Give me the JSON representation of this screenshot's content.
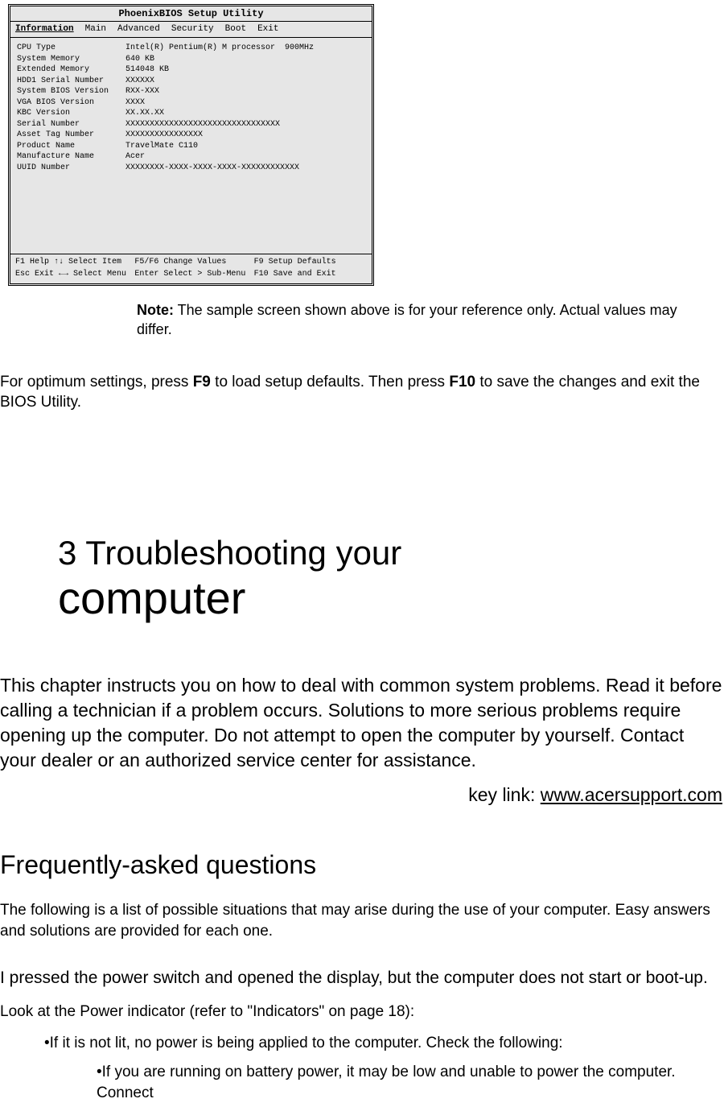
{
  "bios": {
    "title": "PhoenixBIOS Setup Utility",
    "menu": [
      "Information",
      "Main",
      "Advanced",
      "Security",
      "Boot",
      "Exit"
    ],
    "rows": [
      {
        "label": "CPU Type",
        "value": "Intel(R) Pentium(R) M processor  900MHz"
      },
      {
        "label": "System Memory",
        "value": "640 KB"
      },
      {
        "label": "Extended Memory",
        "value": "514048 KB"
      },
      {
        "label": "HDD1 Serial Number",
        "value": "XXXXXX"
      },
      {
        "label": "System BIOS Version",
        "value": "RXX-XXX"
      },
      {
        "label": "VGA BIOS Version",
        "value": "XXXX"
      },
      {
        "label": "KBC Version",
        "value": "XX.XX.XX"
      },
      {
        "label": "Serial Number",
        "value": "XXXXXXXXXXXXXXXXXXXXXXXXXXXXXXXX"
      },
      {
        "label": "Asset Tag Number",
        "value": "XXXXXXXXXXXXXXXX"
      },
      {
        "label": "Product Name",
        "value": "TravelMate C110"
      },
      {
        "label": "Manufacture Name",
        "value": "Acer"
      },
      {
        "label": "UUID Number",
        "value": "XXXXXXXX-XXXX-XXXX-XXXX-XXXXXXXXXXXX"
      }
    ],
    "footer": [
      "F1  Help  ↑↓ Select Item",
      "F5/F6 Change Values",
      "F9  Setup Defaults",
      "Esc Exit  ←→ Select Menu",
      "Enter Select > Sub-Menu",
      "F10 Save and Exit"
    ]
  },
  "note": {
    "label": "Note:",
    "text": "  The sample screen shown above is for your reference only.  Actual values may differ."
  },
  "optimum": {
    "pre": "For optimum settings, press ",
    "k1": "F9",
    "mid": " to load setup defaults.  Then press ",
    "k2": "F10",
    "post": " to save the changes and exit the BIOS Utility."
  },
  "chapter": {
    "line1": "3 Troubleshooting your",
    "line2": "computer",
    "body": "This chapter instructs you on how to deal with common system problems.  Read it before calling a technician if a problem occurs.  Solutions to more serious problems require opening up the computer.  Do not attempt to open the computer by yourself.  Contact your dealer or an authorized service center for assistance.",
    "keylink_label": "key link: ",
    "keylink_url": "www.acersupport.com"
  },
  "faq": {
    "heading": "Frequently-asked questions",
    "intro": "The following is a list of possible situations that may arise during the use of your computer.  Easy answers and solutions are provided for each one.",
    "q1": "I pressed the power switch and opened the display, but the computer does not start or boot-up.",
    "a1": "Look at the Power indicator (refer to \"Indicators\" on page 18):",
    "b1": "•If it is not lit, no power is being applied to the computer.  Check the following:",
    "b2": "•If you are running on battery power, it may be low and unable to power the computer.  Connect"
  }
}
